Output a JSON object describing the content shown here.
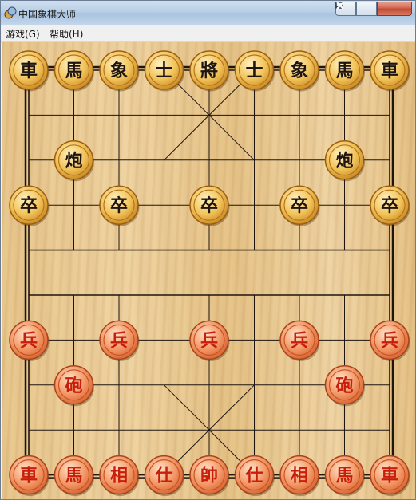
{
  "window": {
    "title": "中国象棋大师",
    "icon": "chinese-chess-app-icon",
    "controls": [
      "minimize-icon",
      "maximize-icon",
      "close-icon"
    ]
  },
  "menu": {
    "game": "游戏(G)",
    "help": "帮助(H)"
  },
  "board": {
    "files": 9,
    "ranks": 10,
    "colors": {
      "line": "#1e1510",
      "black_text": "#1e1510",
      "red_text": "#c81e0a"
    }
  },
  "pieces": [
    {
      "side": "black",
      "label": "車",
      "file": 0,
      "rank": 0
    },
    {
      "side": "black",
      "label": "馬",
      "file": 1,
      "rank": 0
    },
    {
      "side": "black",
      "label": "象",
      "file": 2,
      "rank": 0
    },
    {
      "side": "black",
      "label": "士",
      "file": 3,
      "rank": 0
    },
    {
      "side": "black",
      "label": "將",
      "file": 4,
      "rank": 0
    },
    {
      "side": "black",
      "label": "士",
      "file": 5,
      "rank": 0
    },
    {
      "side": "black",
      "label": "象",
      "file": 6,
      "rank": 0
    },
    {
      "side": "black",
      "label": "馬",
      "file": 7,
      "rank": 0
    },
    {
      "side": "black",
      "label": "車",
      "file": 8,
      "rank": 0
    },
    {
      "side": "black",
      "label": "炮",
      "file": 1,
      "rank": 2
    },
    {
      "side": "black",
      "label": "炮",
      "file": 7,
      "rank": 2
    },
    {
      "side": "black",
      "label": "卒",
      "file": 0,
      "rank": 3
    },
    {
      "side": "black",
      "label": "卒",
      "file": 2,
      "rank": 3
    },
    {
      "side": "black",
      "label": "卒",
      "file": 4,
      "rank": 3
    },
    {
      "side": "black",
      "label": "卒",
      "file": 6,
      "rank": 3
    },
    {
      "side": "black",
      "label": "卒",
      "file": 8,
      "rank": 3
    },
    {
      "side": "red",
      "label": "兵",
      "file": 0,
      "rank": 6
    },
    {
      "side": "red",
      "label": "兵",
      "file": 2,
      "rank": 6
    },
    {
      "side": "red",
      "label": "兵",
      "file": 4,
      "rank": 6
    },
    {
      "side": "red",
      "label": "兵",
      "file": 6,
      "rank": 6
    },
    {
      "side": "red",
      "label": "兵",
      "file": 8,
      "rank": 6
    },
    {
      "side": "red",
      "label": "砲",
      "file": 1,
      "rank": 7
    },
    {
      "side": "red",
      "label": "砲",
      "file": 7,
      "rank": 7
    },
    {
      "side": "red",
      "label": "車",
      "file": 0,
      "rank": 9
    },
    {
      "side": "red",
      "label": "馬",
      "file": 1,
      "rank": 9
    },
    {
      "side": "red",
      "label": "相",
      "file": 2,
      "rank": 9
    },
    {
      "side": "red",
      "label": "仕",
      "file": 3,
      "rank": 9
    },
    {
      "side": "red",
      "label": "帥",
      "file": 4,
      "rank": 9
    },
    {
      "side": "red",
      "label": "仕",
      "file": 5,
      "rank": 9
    },
    {
      "side": "red",
      "label": "相",
      "file": 6,
      "rank": 9
    },
    {
      "side": "red",
      "label": "馬",
      "file": 7,
      "rank": 9
    },
    {
      "side": "red",
      "label": "車",
      "file": 8,
      "rank": 9
    }
  ]
}
